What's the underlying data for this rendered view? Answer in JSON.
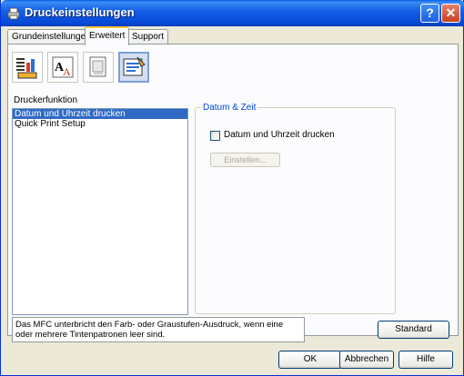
{
  "window": {
    "title": "Druckeinstellungen",
    "help_glyph": "?",
    "close_glyph": "✕"
  },
  "tabs": [
    {
      "label": "Grundeinstellungen",
      "active": false
    },
    {
      "label": "Erweitert",
      "active": true
    },
    {
      "label": "Support",
      "active": false
    }
  ],
  "toolbar_icons": [
    "print-quality-icon",
    "font-icon",
    "copy-icon",
    "device-options-icon"
  ],
  "device_function": {
    "label": "Druckerfunktion",
    "items": [
      "Datum und Uhrzeit drucken",
      "Quick Print Setup"
    ],
    "selected_index": 0
  },
  "datetime_group": {
    "title": "Datum & Zeit",
    "checkbox_label": "Datum und Uhrzeit drucken",
    "checked": false,
    "settings_button": "Einstellen..."
  },
  "message": "Das MFC unterbricht den Farb- oder Graustufen-Ausdruck, wenn eine oder mehrere Tintenpatronen leer sind.",
  "buttons": {
    "standard": "Standard",
    "ok": "OK",
    "cancel": "Abbrechen",
    "help": "Hilfe"
  },
  "colors": {
    "titlebar": "#0548d6",
    "selection": "#316ac5",
    "group_title": "#0046d5"
  }
}
